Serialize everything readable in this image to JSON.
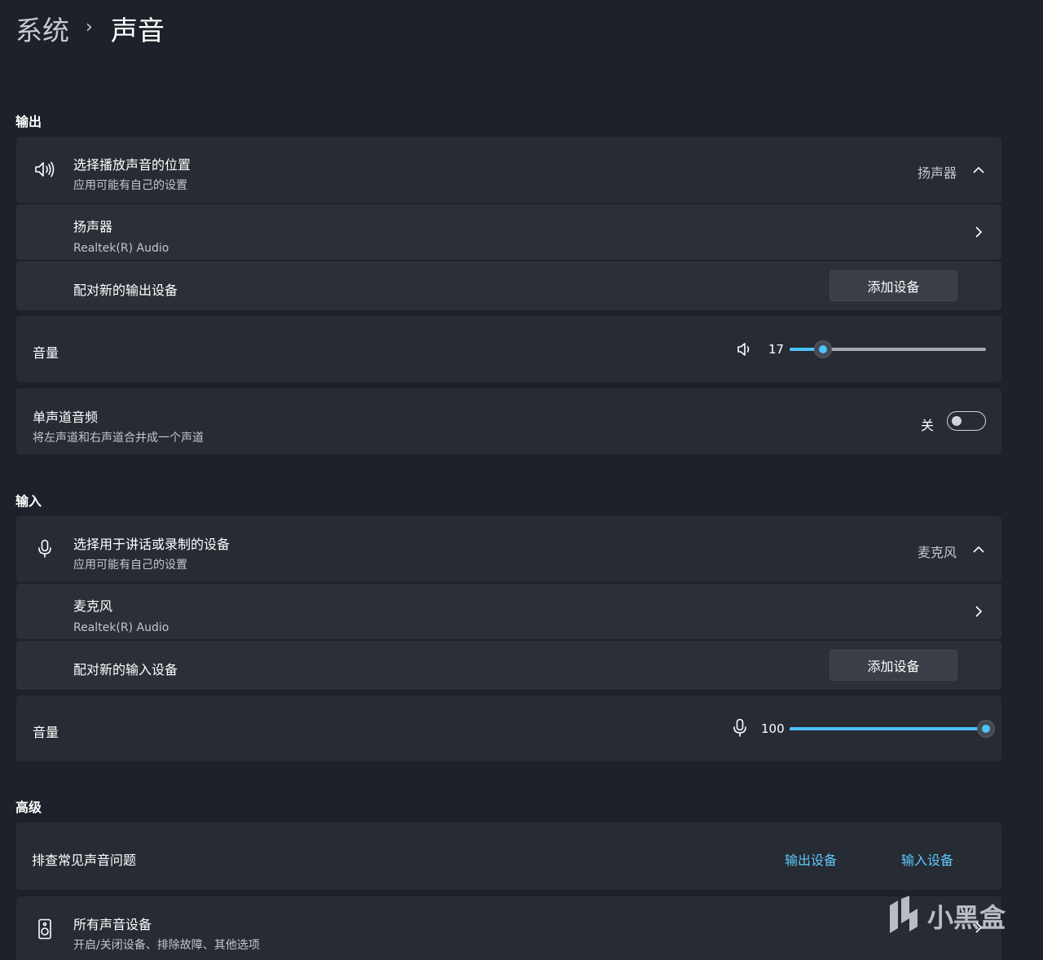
{
  "breadcrumb": {
    "parent": "系统",
    "separator": "›",
    "current": "声音"
  },
  "output": {
    "section_title": "输出",
    "select_device": {
      "title": "选择播放声音的位置",
      "subtitle": "应用可能有自己的设置",
      "value": "扬声器"
    },
    "device": {
      "title": "扬声器",
      "subtitle": "Realtek(R) Audio"
    },
    "pair": {
      "title": "配对新的输出设备",
      "button": "添加设备"
    },
    "volume": {
      "label": "音量",
      "value": "17",
      "level": 0.17
    },
    "mono": {
      "title": "单声道音频",
      "subtitle": "将左声道和右声道合并成一个声道",
      "state_label": "关",
      "on": false
    }
  },
  "input": {
    "section_title": "输入",
    "select_device": {
      "title": "选择用于讲话或录制的设备",
      "subtitle": "应用可能有自己的设置",
      "value": "麦克风"
    },
    "device": {
      "title": "麦克风",
      "subtitle": "Realtek(R) Audio"
    },
    "pair": {
      "title": "配对新的输入设备",
      "button": "添加设备"
    },
    "volume": {
      "label": "音量",
      "value": "100",
      "level": 1.0
    }
  },
  "advanced": {
    "section_title": "高级",
    "troubleshoot": {
      "title": "排查常见声音问题",
      "link_output": "输出设备",
      "link_input": "输入设备"
    },
    "all_devices": {
      "title": "所有声音设备",
      "subtitle": "开启/关闭设备、排除故障、其他选项"
    }
  },
  "watermark": {
    "text": "小黑盒"
  },
  "colors": {
    "background": "#1d2129",
    "card": "#272b33",
    "accent": "#4cc2ff"
  }
}
